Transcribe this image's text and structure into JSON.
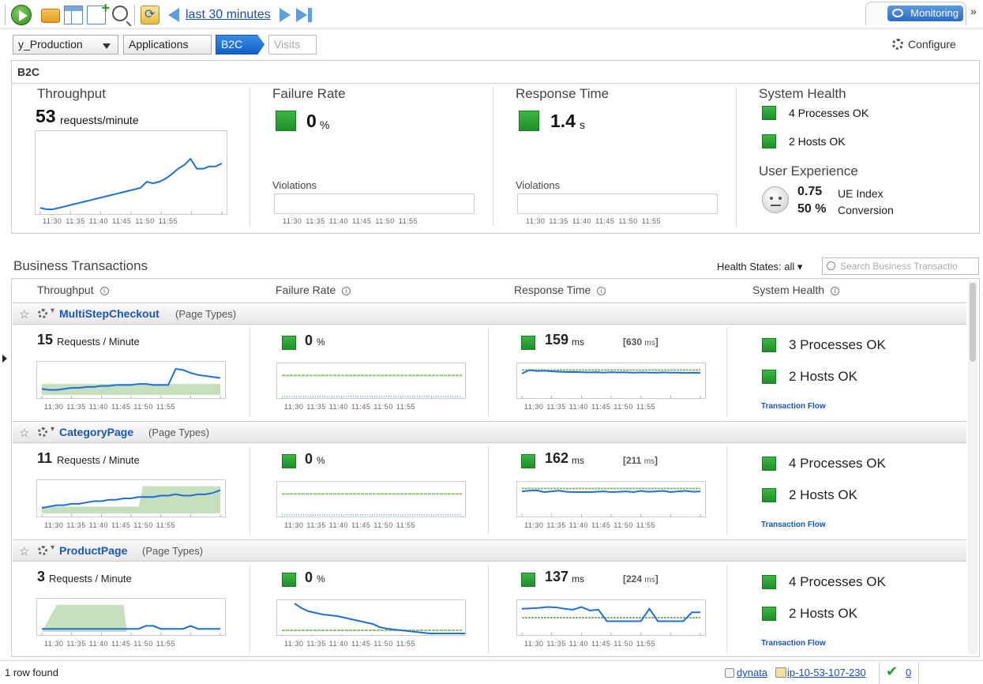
{
  "toolbar": {
    "time_range": "last 30 minutes",
    "monitoring_label": "Monitoring",
    "more": "»"
  },
  "breadcrumb": {
    "profile": "y_Production",
    "applications": "Applications",
    "current": "B2C",
    "next": "Visits"
  },
  "configure_label": "Configure",
  "summary": {
    "title": "B2C",
    "throughput": {
      "title": "Throughput",
      "value": "53",
      "unit": "requests/minute"
    },
    "failure_rate": {
      "title": "Failure Rate",
      "value": "0",
      "unit": "%",
      "violations": "Violations"
    },
    "response_time": {
      "title": "Response Time",
      "value": "1.4",
      "unit": "s",
      "violations": "Violations"
    },
    "system_health": {
      "title": "System Health",
      "processes": "4 Processes OK",
      "hosts": "2 Hosts OK"
    },
    "user_experience": {
      "title": "User Experience",
      "ue_value": "0.75",
      "ue_label": "UE Index",
      "conv_value": "50 %",
      "conv_label": "Conversion"
    }
  },
  "time_ticks": "11:30   11:35   11:40   11:45   11:50   11:55",
  "business_transactions": {
    "title": "Business Transactions",
    "health_filter_label": "Health States:",
    "health_filter_value": "all",
    "search_placeholder": "Search Business Transactio",
    "columns": [
      "Throughput",
      "Failure Rate",
      "Response Time",
      "System Health"
    ],
    "info_icon": "i",
    "rows": [
      {
        "name": "MultiStepCheckout",
        "type": "(Page Types)",
        "throughput": "15",
        "throughput_unit": "Requests / Minute",
        "failure": "0",
        "failure_unit": "%",
        "response": "159",
        "response_unit": "ms",
        "baseline": "[630",
        "baseline_unit": "ms",
        "baseline_close": "]",
        "processes": "3 Processes OK",
        "hosts": "2 Hosts OK",
        "flow": "Transaction Flow"
      },
      {
        "name": "CategoryPage",
        "type": "(Page Types)",
        "throughput": "11",
        "throughput_unit": "Requests / Minute",
        "failure": "0",
        "failure_unit": "%",
        "response": "162",
        "response_unit": "ms",
        "baseline": "[211",
        "baseline_unit": "ms",
        "baseline_close": "]",
        "processes": "4 Processes OK",
        "hosts": "2 Hosts OK",
        "flow": "Transaction Flow"
      },
      {
        "name": "ProductPage",
        "type": "(Page Types)",
        "throughput": "3",
        "throughput_unit": "Requests / Minute",
        "failure": "0",
        "failure_unit": "%",
        "response": "137",
        "response_unit": "ms",
        "baseline": "[224",
        "baseline_unit": "ms",
        "baseline_close": "]",
        "processes": "4 Processes OK",
        "hosts": "2 Hosts OK",
        "flow": "Transaction Flow"
      }
    ]
  },
  "status": {
    "rows_found": "1 row found",
    "user": "dynata",
    "host": "ip-10-53-107-230",
    "count": "0"
  },
  "colors": {
    "accent": "#2a6cc7",
    "ok_green": "#2ea83a",
    "line_blue": "#1f6fd6",
    "baseline_green": "#bcd9b0"
  },
  "chart_data": [
    {
      "type": "line",
      "title": "Throughput",
      "x": [
        "11:27",
        "11:28",
        "11:29",
        "11:30",
        "11:31",
        "11:32",
        "11:33",
        "11:34",
        "11:35",
        "11:36",
        "11:37",
        "11:38",
        "11:39",
        "11:40",
        "11:41",
        "11:42",
        "11:43",
        "11:44",
        "11:45",
        "11:46",
        "11:47",
        "11:48",
        "11:49",
        "11:50",
        "11:51",
        "11:52",
        "11:53",
        "11:54",
        "11:55",
        "11:56"
      ],
      "values": [
        4,
        2,
        2,
        4,
        6,
        8,
        10,
        12,
        14,
        16,
        18,
        20,
        22,
        24,
        26,
        28,
        30,
        38,
        36,
        38,
        42,
        48,
        55,
        60,
        68,
        55,
        55,
        58,
        58,
        62
      ],
      "ylim": [
        0,
        100
      ]
    },
    {
      "type": "line",
      "title": "MultiStepCheckout Throughput",
      "values": [
        6,
        5,
        5,
        6,
        7,
        7,
        8,
        8,
        9,
        9,
        10,
        10,
        10,
        11,
        11,
        10,
        10,
        10,
        26,
        25,
        22,
        20,
        19,
        18,
        17
      ],
      "baseline": 11,
      "ylim": [
        0,
        30
      ]
    },
    {
      "type": "line",
      "title": "MultiStepCheckout Response Time",
      "values": [
        150,
        175,
        168,
        170,
        166,
        163,
        161,
        162,
        160,
        158,
        160,
        157,
        160,
        158,
        159,
        156,
        158,
        157,
        156,
        158,
        157,
        156,
        155,
        156,
        155
      ],
      "baseline": 175,
      "ylim": [
        0,
        200
      ]
    },
    {
      "type": "line",
      "title": "CategoryPage Throughput",
      "values": [
        4,
        5,
        6,
        6,
        7,
        7,
        8,
        9,
        9,
        10,
        10,
        11,
        11,
        12,
        12,
        12,
        13,
        13,
        14,
        13,
        13,
        14,
        14,
        15,
        17
      ],
      "baseline_low": 4,
      "baseline_high": 20,
      "ylim": [
        0,
        22
      ]
    },
    {
      "type": "line",
      "title": "CategoryPage Response Time",
      "values": [
        155,
        160,
        162,
        150,
        155,
        160,
        152,
        150,
        150,
        150,
        152,
        155,
        150,
        152,
        155,
        150,
        158,
        152,
        155,
        158,
        150,
        155,
        158,
        152,
        155
      ],
      "baseline": 175,
      "ylim": [
        0,
        200
      ]
    },
    {
      "type": "line",
      "title": "ProductPage Throughput",
      "values": [
        1,
        1,
        1,
        1,
        1,
        1,
        1,
        1,
        1,
        1,
        1,
        1,
        1,
        1,
        2,
        2,
        1,
        1,
        1,
        1,
        2,
        1,
        1,
        1,
        1
      ],
      "baseline_high": 9,
      "ylim": [
        0,
        10
      ]
    },
    {
      "type": "line",
      "title": "ProductPage Response Time",
      "values": [
        130,
        132,
        135,
        140,
        138,
        130,
        125,
        140,
        120,
        125,
        60,
        60,
        60,
        60,
        60,
        130,
        60,
        60,
        60,
        60,
        110,
        110
      ],
      "baseline": 80,
      "ylim": [
        0,
        160
      ]
    }
  ]
}
